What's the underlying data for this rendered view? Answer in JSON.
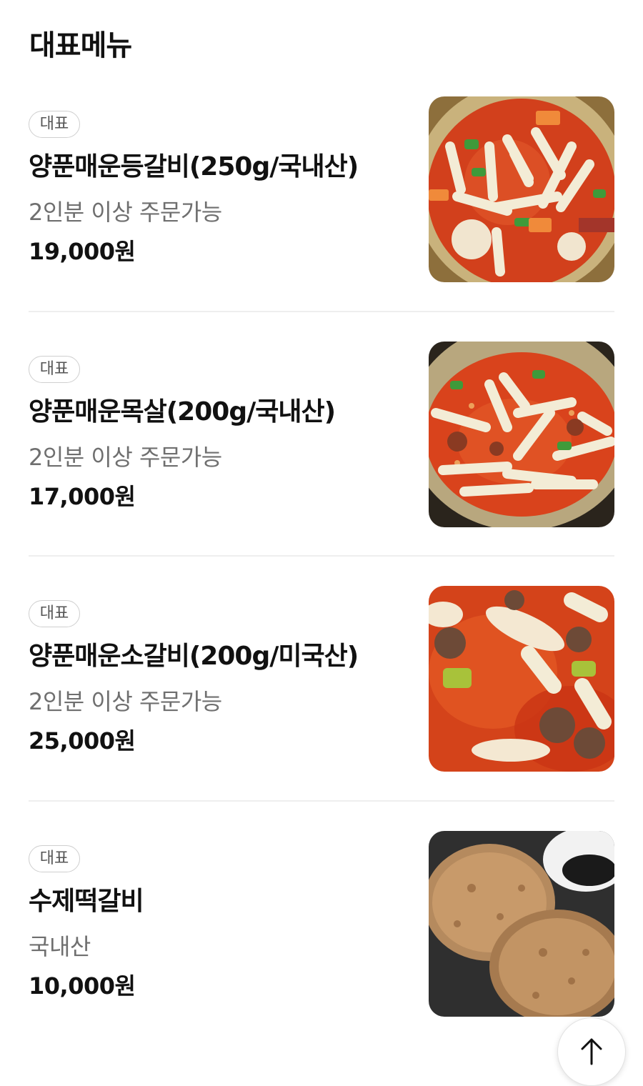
{
  "section": {
    "title": "대표메뉴"
  },
  "menu": [
    {
      "badge": "대표",
      "name": "양푼매운등갈비(250g/국내산)",
      "description": "2인분 이상 주문가능",
      "price": "19,000원",
      "image": "spicy-pork-back-ribs-stew-photo"
    },
    {
      "badge": "대표",
      "name": "양푼매운목살(200g/국내산)",
      "description": "2인분 이상 주문가능",
      "price": "17,000원",
      "image": "spicy-pork-neck-stew-photo"
    },
    {
      "badge": "대표",
      "name": "양푼매운소갈비(200g/미국산)",
      "description": "2인분 이상 주문가능",
      "price": "25,000원",
      "image": "spicy-beef-short-ribs-stew-photo"
    },
    {
      "badge": "대표",
      "name": "수제떡갈비",
      "description": "국내산",
      "price": "10,000원",
      "image": "handmade-tteokgalbi-patty-photo"
    }
  ],
  "scroll_top": {
    "icon": "arrow-up-icon"
  },
  "colors": {
    "text_primary": "#111111",
    "text_secondary": "#6f6f6f",
    "badge_border": "#cfcfcf",
    "divider": "#eeeeee",
    "stew_red": "#d2401c",
    "rice_cake": "#f3ecd6",
    "pot_gold": "#b8a77e"
  }
}
